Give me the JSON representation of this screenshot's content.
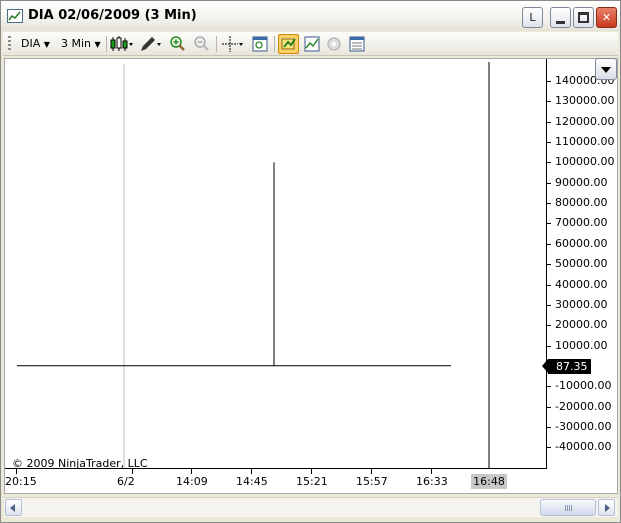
{
  "window": {
    "title": "DIA  02/06/2009 (3 Min)",
    "buttons": {
      "link_label": "L"
    }
  },
  "toolbar": {
    "instrument": "DIA",
    "interval": "3 Min",
    "icons": [
      "candlestick-icon",
      "pencil-draw-icon",
      "zoom-in-icon",
      "zoom-out-icon",
      "crosshair-icon",
      "data-box-icon",
      "chart-trader-icon",
      "indicators-icon",
      "strategies-icon",
      "properties-icon"
    ]
  },
  "chart": {
    "copyright": "© 2009 NinjaTrader, LLC",
    "current_price_label": "87.35",
    "current_time_label": "16:48",
    "y_tick_labels": [
      "140000.00",
      "130000.00",
      "120000.00",
      "110000.00",
      "100000.00",
      "90000.00",
      "80000.00",
      "70000.00",
      "60000.00",
      "50000.00",
      "40000.00",
      "30000.00",
      "20000.00",
      "10000.00",
      "0.00",
      "-10000.00",
      "-20000.00",
      "-30000.00",
      "-40000.00"
    ],
    "x_tick_labels": [
      "20:15",
      "6/2",
      "14:09",
      "14:45",
      "15:21",
      "15:57",
      "16:33"
    ]
  },
  "chart_data": {
    "type": "line",
    "y_values_visible": [
      140000,
      130000,
      120000,
      110000,
      100000,
      90000,
      80000,
      70000,
      60000,
      50000,
      40000,
      30000,
      20000,
      10000,
      0,
      -10000,
      -20000,
      -30000,
      -40000
    ],
    "price_marker": 87.35,
    "spike_high": 100000,
    "ylim": [
      -45000,
      145000
    ],
    "grid": false,
    "legend": "none"
  },
  "colors": {
    "close_button": "#c8381c",
    "pressed_button": "#fbd06a",
    "price_badge": "#000000"
  }
}
